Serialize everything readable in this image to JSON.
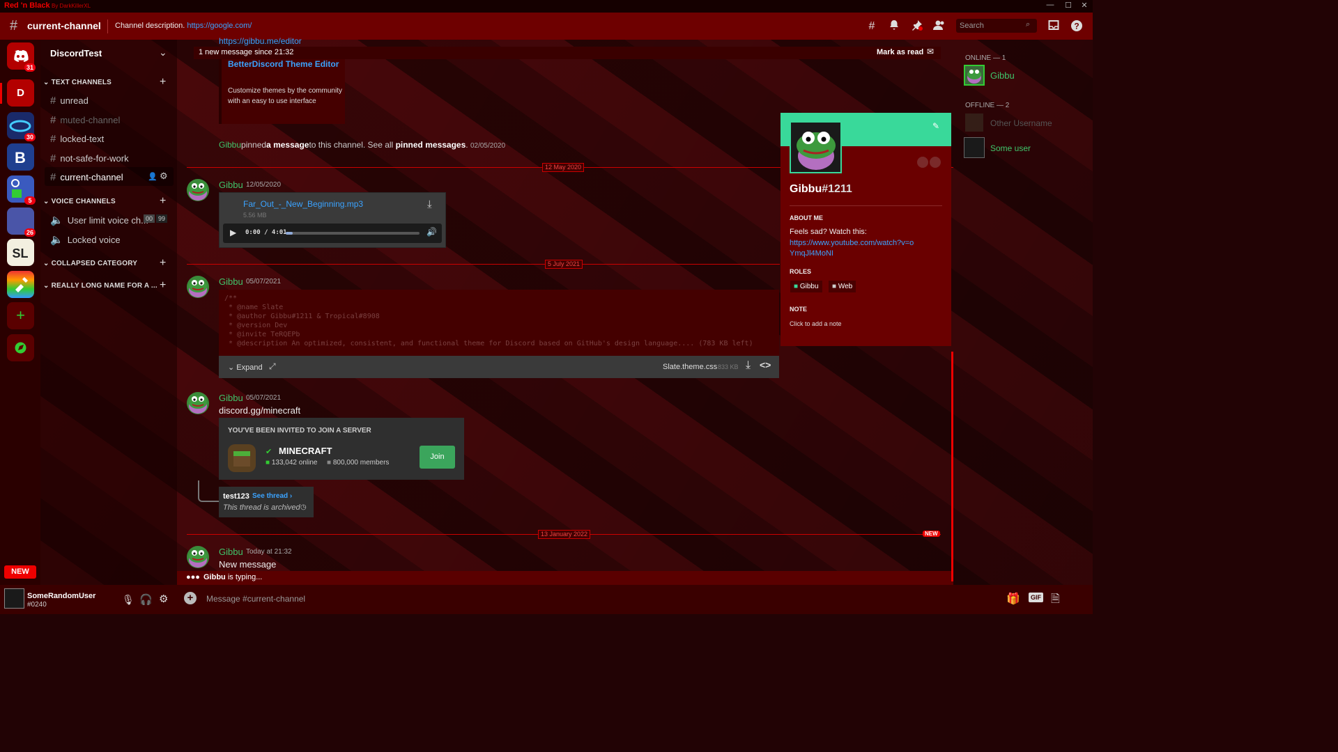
{
  "titlebar": {
    "theme": "Red 'n Black",
    "by": "By DarkKillerXL",
    "min": "—",
    "max": "☐",
    "close": "✕"
  },
  "header": {
    "channel": "current-channel",
    "description": "Channel description.",
    "link": "https://google.com/",
    "search_placeholder": "Search"
  },
  "servers": {
    "badges": [
      "31",
      "30",
      "5",
      "26"
    ],
    "d_label": "D",
    "new_label": "NEW"
  },
  "sidebar": {
    "server_name": "DiscordTest",
    "text_category": "TEXT CHANNELS",
    "text_channels": [
      "unread",
      "muted-channel",
      "locked-text",
      "not-safe-for-work",
      "current-channel"
    ],
    "voice_category": "VOICE CHANNELS",
    "voice_channels": [
      "User limit voice ch...",
      "Locked voice"
    ],
    "voice_limit_a": "00",
    "voice_limit_b": "99",
    "collapsed_category": "COLLAPSED CATEGORY",
    "long_category": "REALLY LONG NAME FOR A ..."
  },
  "chat": {
    "top_link": "https://gibbu.me/editor",
    "new_bar": "1 new message since 21:32",
    "mark_read": "Mark as read",
    "embed_title": "BetterDiscord Theme Editor",
    "embed_desc": "Customize themes by the community with an easy to use interface",
    "pin_user": "Gibbu",
    "pin_text1": "pinned",
    "pin_text2": "a message",
    "pin_text3": "to this channel. See all",
    "pin_text4": "pinned messages",
    "pin_text5": ".",
    "pin_ts": "02/05/2020",
    "date1": "12 May 2020",
    "date2": "5 July 2021",
    "date3": "13 January 2022",
    "new_tag": "NEW",
    "m1_user": "Gibbu",
    "m1_ts": "12/05/2020",
    "audio_name": "Far_Out_-_New_Beginning.mp3",
    "audio_size": "5.56 MB",
    "audio_time": "0:00 / 4:01",
    "audio_progress": 0.05,
    "m2_user": "Gibbu",
    "m2_ts": "05/07/2021",
    "code_lines": [
      "/**",
      " * @name Slate",
      " * @author Gibbu#1211 & Tropical#8908",
      " * @version Dev",
      " * @invite TeRQEPb",
      " * @description An optimized, consistent, and functional theme for Discord based on GitHub's design language.... (783 KB left)"
    ],
    "expand": "Expand",
    "file_name": "Slate.theme.css",
    "file_size": "833 KB",
    "m3_user": "Gibbu",
    "m3_ts": "05/07/2021",
    "m3_text": "discord.gg/minecraft",
    "invite_head": "YOU'VE BEEN INVITED TO JOIN A SERVER",
    "invite_name": "MINECRAFT",
    "invite_online": "133,042 online",
    "invite_members": "800,000 members",
    "join": "Join",
    "thread_name": "test123",
    "thread_link": "See thread ›",
    "thread_status": "This thread is archived",
    "m4_user": "Gibbu",
    "m4_ts": "Today at 21:32",
    "m4_text": "New message",
    "typing_user": "Gibbu",
    "typing_text": " is typing..."
  },
  "members": {
    "online_header": "ONLINE — 1",
    "online": [
      "Gibbu"
    ],
    "offline_header": "OFFLINE — 2",
    "offline": [
      "Other Username",
      "Some user"
    ]
  },
  "profile": {
    "name": "Gibbu",
    "tag": "#1211",
    "about_h": "ABOUT ME",
    "about": "Feels sad? Watch this:",
    "about_link": "https://www.youtube.com/watch?v=oYmqJl4MoNI",
    "roles_h": "ROLES",
    "roles": [
      "Gibbu",
      "Web"
    ],
    "note_h": "NOTE",
    "note": "Click to add a note",
    "banner_color": "#39d99a"
  },
  "user": {
    "name": "SomeRandomUser",
    "tag": "#0240"
  },
  "composer": {
    "placeholder": "Message #current-channel",
    "gif": "GIF"
  }
}
